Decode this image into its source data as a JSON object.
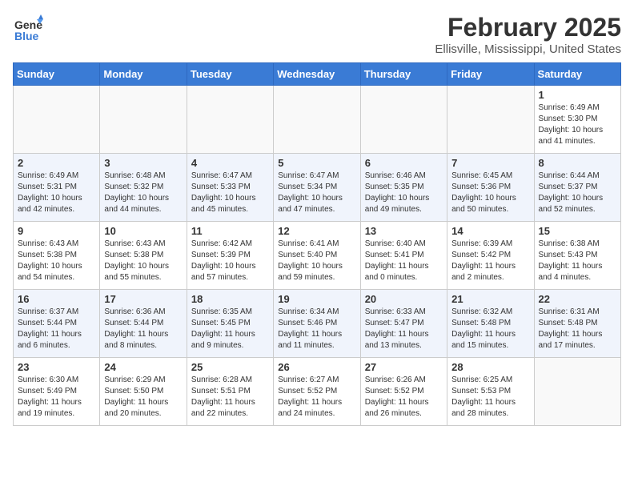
{
  "logo": {
    "general": "General",
    "blue": "Blue"
  },
  "title": "February 2025",
  "subtitle": "Ellisville, Mississippi, United States",
  "weekdays": [
    "Sunday",
    "Monday",
    "Tuesday",
    "Wednesday",
    "Thursday",
    "Friday",
    "Saturday"
  ],
  "weeks": [
    [
      {
        "day": "",
        "info": ""
      },
      {
        "day": "",
        "info": ""
      },
      {
        "day": "",
        "info": ""
      },
      {
        "day": "",
        "info": ""
      },
      {
        "day": "",
        "info": ""
      },
      {
        "day": "",
        "info": ""
      },
      {
        "day": "1",
        "info": "Sunrise: 6:49 AM\nSunset: 5:30 PM\nDaylight: 10 hours\nand 41 minutes."
      }
    ],
    [
      {
        "day": "2",
        "info": "Sunrise: 6:49 AM\nSunset: 5:31 PM\nDaylight: 10 hours\nand 42 minutes."
      },
      {
        "day": "3",
        "info": "Sunrise: 6:48 AM\nSunset: 5:32 PM\nDaylight: 10 hours\nand 44 minutes."
      },
      {
        "day": "4",
        "info": "Sunrise: 6:47 AM\nSunset: 5:33 PM\nDaylight: 10 hours\nand 45 minutes."
      },
      {
        "day": "5",
        "info": "Sunrise: 6:47 AM\nSunset: 5:34 PM\nDaylight: 10 hours\nand 47 minutes."
      },
      {
        "day": "6",
        "info": "Sunrise: 6:46 AM\nSunset: 5:35 PM\nDaylight: 10 hours\nand 49 minutes."
      },
      {
        "day": "7",
        "info": "Sunrise: 6:45 AM\nSunset: 5:36 PM\nDaylight: 10 hours\nand 50 minutes."
      },
      {
        "day": "8",
        "info": "Sunrise: 6:44 AM\nSunset: 5:37 PM\nDaylight: 10 hours\nand 52 minutes."
      }
    ],
    [
      {
        "day": "9",
        "info": "Sunrise: 6:43 AM\nSunset: 5:38 PM\nDaylight: 10 hours\nand 54 minutes."
      },
      {
        "day": "10",
        "info": "Sunrise: 6:43 AM\nSunset: 5:38 PM\nDaylight: 10 hours\nand 55 minutes."
      },
      {
        "day": "11",
        "info": "Sunrise: 6:42 AM\nSunset: 5:39 PM\nDaylight: 10 hours\nand 57 minutes."
      },
      {
        "day": "12",
        "info": "Sunrise: 6:41 AM\nSunset: 5:40 PM\nDaylight: 10 hours\nand 59 minutes."
      },
      {
        "day": "13",
        "info": "Sunrise: 6:40 AM\nSunset: 5:41 PM\nDaylight: 11 hours\nand 0 minutes."
      },
      {
        "day": "14",
        "info": "Sunrise: 6:39 AM\nSunset: 5:42 PM\nDaylight: 11 hours\nand 2 minutes."
      },
      {
        "day": "15",
        "info": "Sunrise: 6:38 AM\nSunset: 5:43 PM\nDaylight: 11 hours\nand 4 minutes."
      }
    ],
    [
      {
        "day": "16",
        "info": "Sunrise: 6:37 AM\nSunset: 5:44 PM\nDaylight: 11 hours\nand 6 minutes."
      },
      {
        "day": "17",
        "info": "Sunrise: 6:36 AM\nSunset: 5:44 PM\nDaylight: 11 hours\nand 8 minutes."
      },
      {
        "day": "18",
        "info": "Sunrise: 6:35 AM\nSunset: 5:45 PM\nDaylight: 11 hours\nand 9 minutes."
      },
      {
        "day": "19",
        "info": "Sunrise: 6:34 AM\nSunset: 5:46 PM\nDaylight: 11 hours\nand 11 minutes."
      },
      {
        "day": "20",
        "info": "Sunrise: 6:33 AM\nSunset: 5:47 PM\nDaylight: 11 hours\nand 13 minutes."
      },
      {
        "day": "21",
        "info": "Sunrise: 6:32 AM\nSunset: 5:48 PM\nDaylight: 11 hours\nand 15 minutes."
      },
      {
        "day": "22",
        "info": "Sunrise: 6:31 AM\nSunset: 5:48 PM\nDaylight: 11 hours\nand 17 minutes."
      }
    ],
    [
      {
        "day": "23",
        "info": "Sunrise: 6:30 AM\nSunset: 5:49 PM\nDaylight: 11 hours\nand 19 minutes."
      },
      {
        "day": "24",
        "info": "Sunrise: 6:29 AM\nSunset: 5:50 PM\nDaylight: 11 hours\nand 20 minutes."
      },
      {
        "day": "25",
        "info": "Sunrise: 6:28 AM\nSunset: 5:51 PM\nDaylight: 11 hours\nand 22 minutes."
      },
      {
        "day": "26",
        "info": "Sunrise: 6:27 AM\nSunset: 5:52 PM\nDaylight: 11 hours\nand 24 minutes."
      },
      {
        "day": "27",
        "info": "Sunrise: 6:26 AM\nSunset: 5:52 PM\nDaylight: 11 hours\nand 26 minutes."
      },
      {
        "day": "28",
        "info": "Sunrise: 6:25 AM\nSunset: 5:53 PM\nDaylight: 11 hours\nand 28 minutes."
      },
      {
        "day": "",
        "info": ""
      }
    ]
  ]
}
